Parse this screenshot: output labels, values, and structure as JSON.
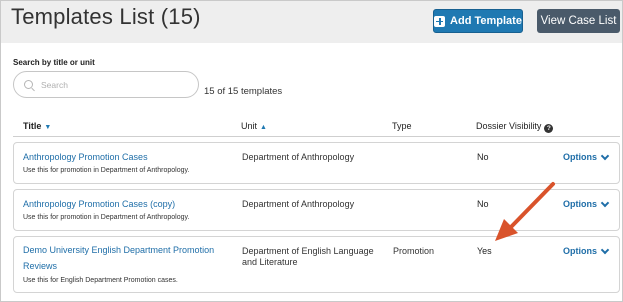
{
  "header": {
    "title": "Templates List (15)",
    "add_button": "Add Template",
    "view_button": "View Case List"
  },
  "search": {
    "label": "Search by title or unit",
    "placeholder": "Search",
    "count_text": "15 of 15 templates"
  },
  "columns": {
    "title": "Title",
    "unit": "Unit",
    "type": "Type",
    "dossier": "Dossier Visibility"
  },
  "rows": [
    {
      "title": "Anthropology Promotion Cases",
      "description": "Use this for promotion in Department of Anthropology.",
      "unit": "Department of Anthropology",
      "type": "",
      "dossier": "No",
      "options": "Options"
    },
    {
      "title": "Anthropology Promotion Cases (copy)",
      "description": "Use this for promotion in Department of Anthropology.",
      "unit": "Department of Anthropology",
      "type": "",
      "dossier": "No",
      "options": "Options"
    },
    {
      "title": "Demo University English Department Promotion Reviews",
      "description": "Use this for English Department Promotion cases.",
      "unit": "Department of English Language and Literature",
      "type": "Promotion",
      "dossier": "Yes",
      "options": "Options"
    }
  ],
  "colors": {
    "accent": "#1f79b2",
    "link": "#1f6ea8",
    "secondary_button": "#4a5a6a",
    "annotation_arrow": "#d9532b"
  }
}
